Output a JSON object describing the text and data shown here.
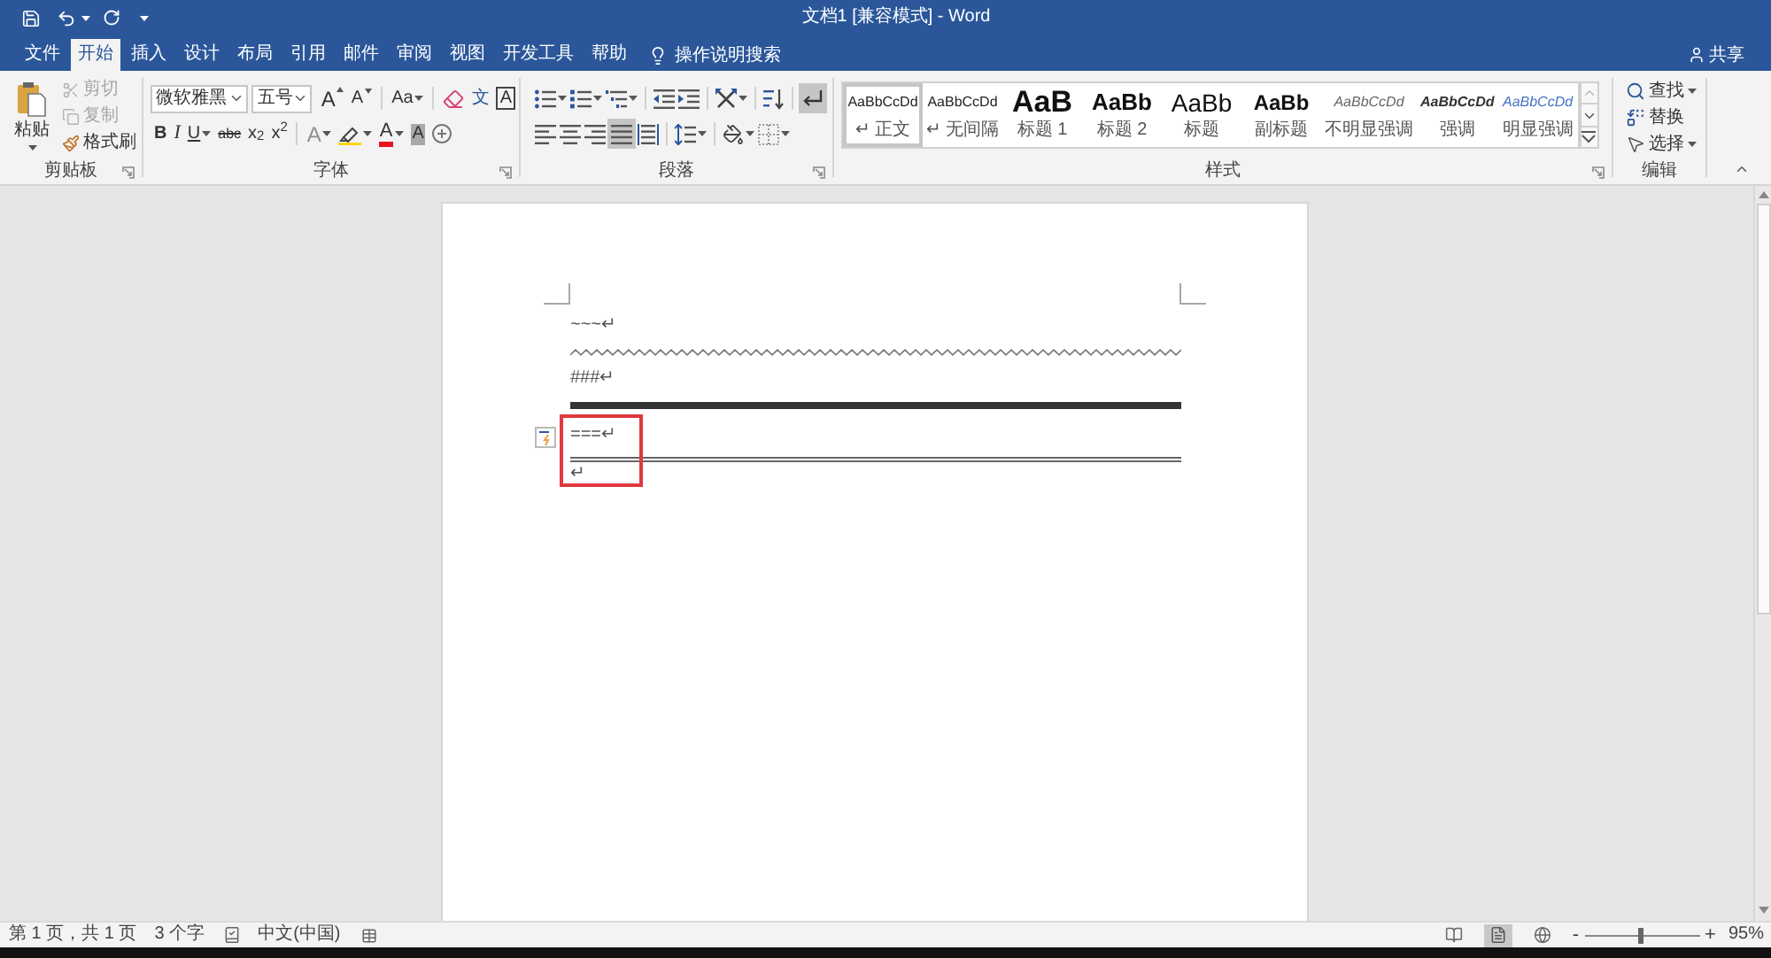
{
  "window": {
    "title": "文档1 [兼容模式] - Word"
  },
  "tabs": [
    {
      "label": "文件",
      "selected": false
    },
    {
      "label": "开始",
      "selected": true
    },
    {
      "label": "插入",
      "selected": false
    },
    {
      "label": "设计",
      "selected": false
    },
    {
      "label": "布局",
      "selected": false
    },
    {
      "label": "引用",
      "selected": false
    },
    {
      "label": "邮件",
      "selected": false
    },
    {
      "label": "审阅",
      "selected": false
    },
    {
      "label": "视图",
      "selected": false
    },
    {
      "label": "开发工具",
      "selected": false
    },
    {
      "label": "帮助",
      "selected": false
    }
  ],
  "tell_me": {
    "label": "操作说明搜索"
  },
  "share": {
    "label": "共享"
  },
  "clipboard": {
    "group_label": "剪贴板",
    "paste": {
      "label": "粘贴"
    },
    "items": [
      {
        "kind": "cut",
        "label": "剪切",
        "disabled": true
      },
      {
        "kind": "copy",
        "label": "复制",
        "disabled": true
      },
      {
        "kind": "format_painter",
        "label": "格式刷",
        "disabled": false
      }
    ]
  },
  "font": {
    "group_label": "字体",
    "font_name": "微软雅黑",
    "font_size": "五号",
    "row_1": [
      [
        {
          "kind": "grow",
          "label": "A"
        },
        {
          "kind": "shrink",
          "label": "A"
        }
      ],
      [
        {
          "kind": "change_case",
          "label": "Aa",
          "dropdown": true
        }
      ],
      [
        {
          "kind": "clear_formatting"
        },
        {
          "kind": "phonetic_guide",
          "label": "文"
        },
        {
          "kind": "character_border",
          "label": "A"
        }
      ]
    ],
    "row_2": [
      [
        {
          "kind": "bold",
          "label": "B"
        },
        {
          "kind": "italic",
          "label": "I"
        },
        {
          "kind": "underline",
          "label": "U",
          "dropdown": true
        },
        {
          "kind": "strikethrough",
          "label": "abc"
        },
        {
          "kind": "subscript",
          "label": "x$_{2}$"
        },
        {
          "kind": "superscript",
          "label": "x$^{2}$"
        }
      ],
      [
        {
          "kind": "text_effects",
          "label": "A",
          "dropdown": true
        },
        {
          "kind": "highlight",
          "dropdown": true
        },
        {
          "kind": "font_color",
          "label": "A",
          "dropdown": true
        },
        {
          "kind": "character_shading",
          "label": "A"
        },
        {
          "kind": "enclose_characters"
        }
      ]
    ]
  },
  "paragraph": {
    "group_label": "段落",
    "row_1": [
      [
        {
          "kind": "bullets",
          "dropdown": true,
          "selected": false
        },
        {
          "kind": "numbering",
          "dropdown": true,
          "selected": false
        },
        {
          "kind": "multilevel_list",
          "dropdown": true,
          "selected": false
        }
      ],
      [
        {
          "kind": "decrease_indent",
          "selected": false
        },
        {
          "kind": "increase_indent",
          "selected": false
        }
      ],
      [
        {
          "kind": "chinese_layout",
          "dropdown": true,
          "selected": false
        }
      ],
      [
        {
          "kind": "sort",
          "selected": false
        }
      ],
      [
        {
          "kind": "show_marks",
          "selected": true
        }
      ]
    ],
    "row_2": [
      [
        {
          "kind": "align_left",
          "selected": false
        },
        {
          "kind": "center",
          "selected": false
        },
        {
          "kind": "align_right",
          "selected": false
        },
        {
          "kind": "justify",
          "selected": true
        },
        {
          "kind": "distributed",
          "selected": false
        }
      ],
      [
        {
          "kind": "line_spacing",
          "dropdown": true,
          "selected": false
        }
      ],
      [
        {
          "kind": "shading",
          "dropdown": true,
          "selected": false
        },
        {
          "kind": "borders",
          "dropdown": true,
          "selected": false
        }
      ]
    ]
  },
  "styles": {
    "group_label": "样式",
    "items": [
      {
        "kind": "normal",
        "preview": "AaBbCcDd",
        "label": "↵ 正文",
        "selected": true
      },
      {
        "kind": "no_spacing",
        "preview": "AaBbCcDd",
        "label": "↵ 无间隔",
        "selected": false
      },
      {
        "kind": "heading_1",
        "preview": "AaB",
        "label": "标题 1",
        "selected": false
      },
      {
        "kind": "heading_2",
        "preview": "AaBb",
        "label": "标题 2",
        "selected": false
      },
      {
        "kind": "title",
        "preview": "AaBb",
        "label": "标题",
        "selected": false
      },
      {
        "kind": "subtitle",
        "preview": "AaBb",
        "label": "副标题",
        "selected": false
      },
      {
        "kind": "subtle_emphasis",
        "preview": "AaBbCcDd",
        "label": "不明显强调",
        "selected": false
      },
      {
        "kind": "emphasis",
        "preview": "AaBbCcDd",
        "label": "强调",
        "selected": false
      },
      {
        "kind": "intense_emphasis",
        "preview": "AaBbCcDd",
        "label": "明显强调",
        "selected": false
      }
    ]
  },
  "editing": {
    "group_label": "编辑",
    "items": [
      {
        "kind": "find",
        "label": "查找",
        "dropdown": true
      },
      {
        "kind": "replace",
        "label": "替换"
      },
      {
        "kind": "select",
        "label": "选择",
        "dropdown": true
      }
    ]
  },
  "document": {
    "paragraphs": [
      {
        "kind": "wavy",
        "text": "~~~↵",
        "layout_options": false
      },
      {
        "kind": "thick",
        "text": "###↵",
        "layout_options": false
      },
      {
        "kind": "double",
        "text": "===↵",
        "layout_options": true
      },
      {
        "kind": "plain",
        "text": "↵",
        "layout_options": false
      }
    ],
    "annotation": {
      "kind": "rectangle"
    }
  },
  "status_bar": {
    "page": "第 1 页，共 1 页",
    "word_count": "3 个字",
    "language": "中文(中国)",
    "views": [
      {
        "kind": "read_mode",
        "selected": false
      },
      {
        "kind": "print_layout",
        "selected": true
      },
      {
        "kind": "web_layout",
        "selected": false
      }
    ],
    "zoom_out": "-",
    "zoom_slider": {
      "level": 0.49
    },
    "zoom_in": "+",
    "zoom": "95%"
  }
}
